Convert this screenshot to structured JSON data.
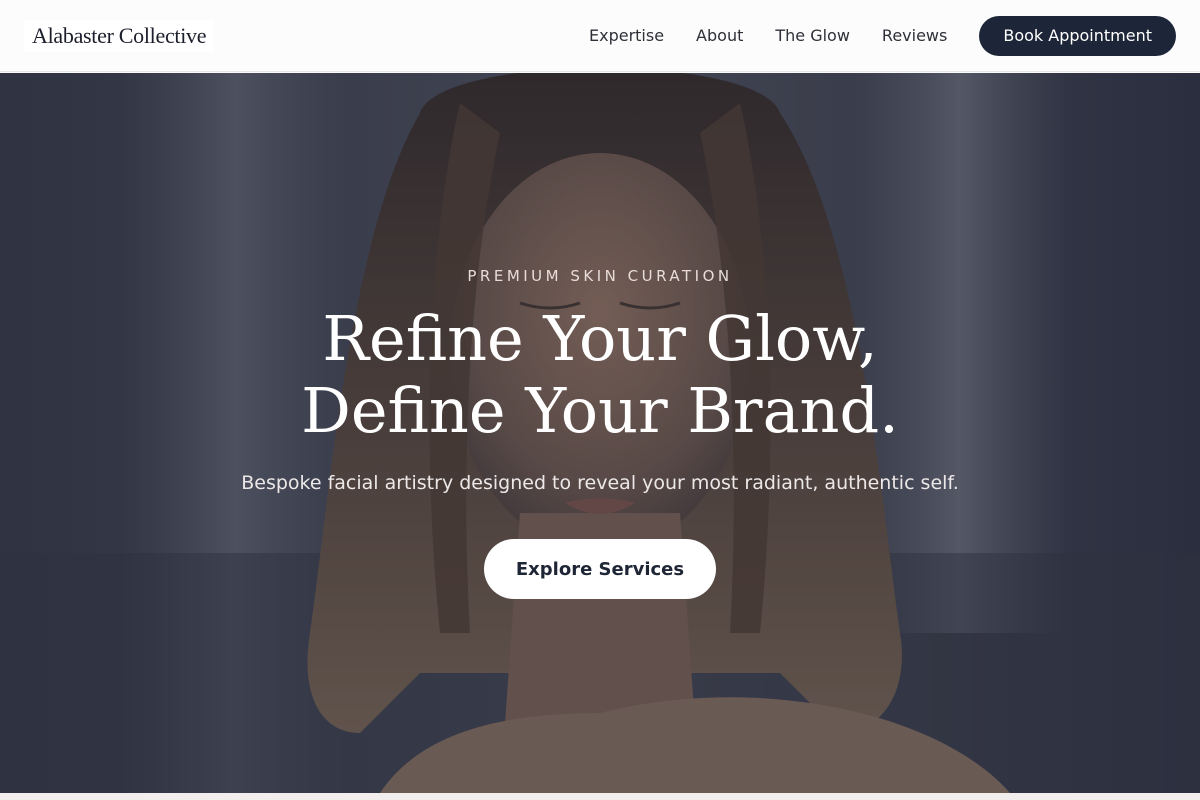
{
  "header": {
    "logo": "Alabaster Collective",
    "nav": [
      {
        "label": "Expertise"
      },
      {
        "label": "About"
      },
      {
        "label": "The Glow"
      },
      {
        "label": "Reviews"
      }
    ],
    "cta_label": "Book Appointment"
  },
  "hero": {
    "eyebrow": "PREMIUM SKIN CURATION",
    "title_line1": "Refine Your Glow,",
    "title_line2": "Define Your Brand.",
    "subtitle": "Bespoke facial artistry designed to reveal your most radiant, authentic self.",
    "cta_label": "Explore Services"
  },
  "colors": {
    "accent_dark": "#1d2638",
    "hero_text": "#ffffff",
    "eyebrow_text": "#e8dcd8"
  }
}
